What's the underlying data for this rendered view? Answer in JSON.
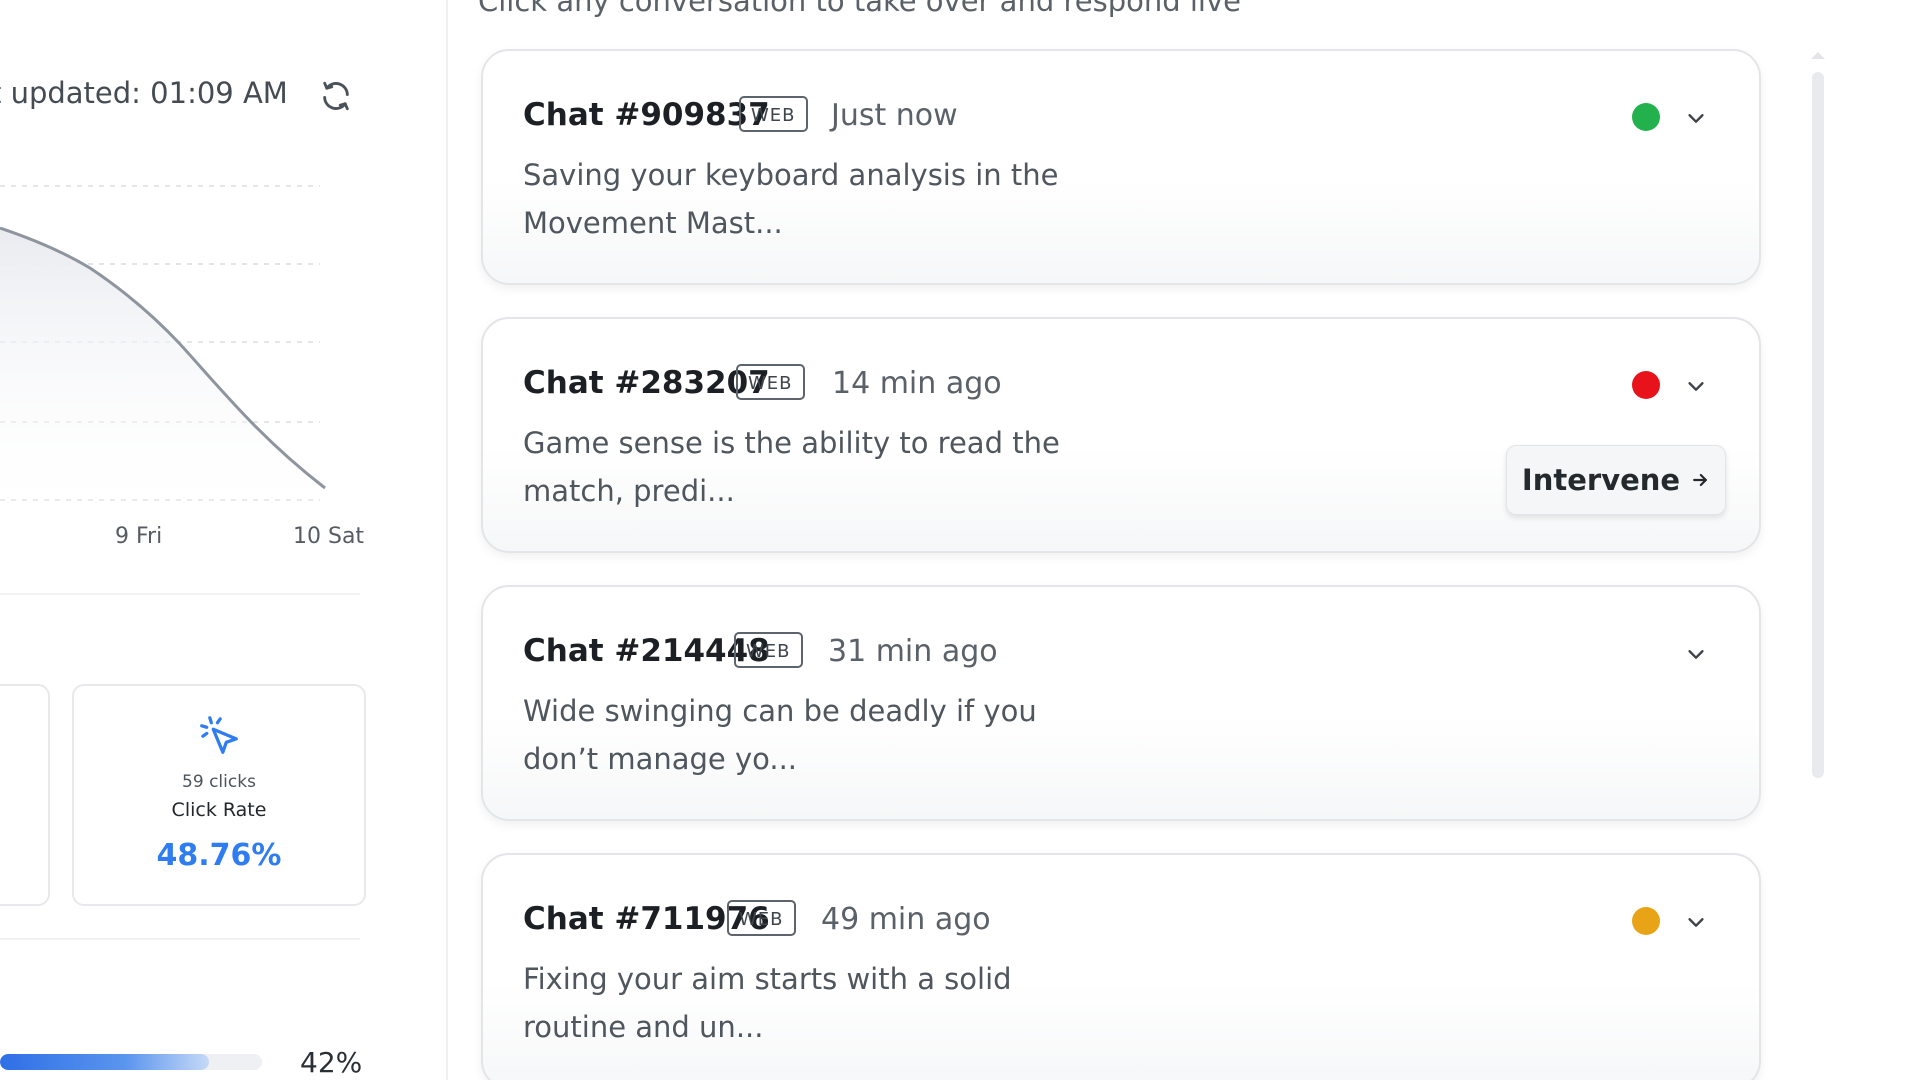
{
  "left": {
    "last_updated": "t updated: 01:09 AM",
    "chart": {
      "ticks": [
        "9 Fri",
        "10 Sat"
      ]
    },
    "stat_card": {
      "icon": "cursor-click-icon",
      "clicks": "59 clicks",
      "label": "Click Rate",
      "value": "48.76%",
      "accent": "#2f7df0"
    },
    "progress": {
      "value": 0.42,
      "label": "42%"
    }
  },
  "right": {
    "subtitle": "Click any conversation to take over and respond live",
    "chats": [
      {
        "title": "Chat #909837",
        "badge": "WEB",
        "time": "Just now",
        "preview_line1": "Saving your keyboard analysis in the",
        "preview_line2": "Movement Mast...",
        "status_color": "#22b14c",
        "show_intervene": false
      },
      {
        "title": "Chat #283207",
        "badge": "WEB",
        "time": "14 min ago",
        "preview_line1": "Game sense is the ability to read the",
        "preview_line2": "match, predi...",
        "status_color": "#e8121a",
        "show_intervene": true,
        "intervene_label": "Intervene"
      },
      {
        "title": "Chat #214448",
        "badge": "WEB",
        "time": "31 min ago",
        "preview_line1": "Wide swinging can be deadly if you",
        "preview_line2": "don’t manage yo...",
        "status_color": null,
        "show_intervene": false
      },
      {
        "title": "Chat #711976",
        "badge": "WEB",
        "time": "49 min ago",
        "preview_line1": "Fixing your aim starts with a solid",
        "preview_line2": "routine and un...",
        "status_color": "#e8a416",
        "show_intervene": false
      }
    ]
  }
}
